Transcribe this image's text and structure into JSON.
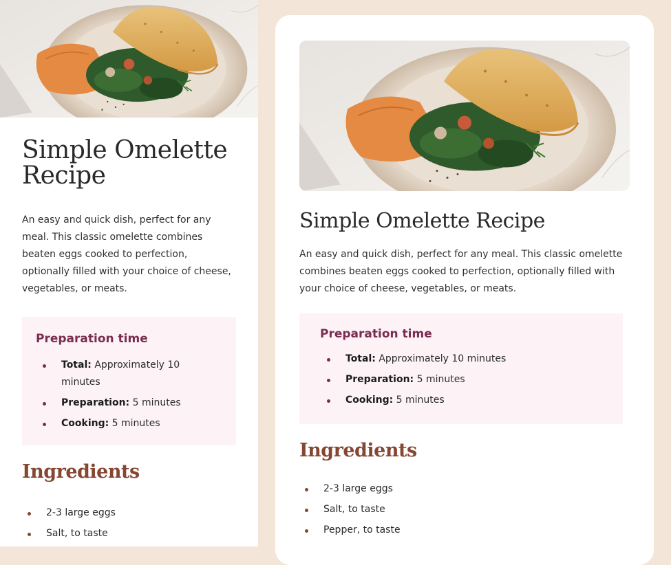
{
  "recipe": {
    "title": "Simple Omelette Recipe",
    "description": "An easy and quick dish, perfect for any meal. This classic omelette combines beaten eggs cooked to perfection, optionally filled with your choice of cheese, vegetables, or meats.",
    "preparation": {
      "heading": "Preparation time",
      "items": [
        {
          "label": "Total:",
          "value": "Approximately 10 minutes"
        },
        {
          "label": "Preparation:",
          "value": "5 minutes"
        },
        {
          "label": "Cooking:",
          "value": "5 minutes"
        }
      ]
    },
    "ingredients": {
      "heading": "Ingredients",
      "items": [
        "2-3 large eggs",
        "Salt, to taste",
        "Pepper, to taste"
      ]
    }
  },
  "image": {
    "icon": "omelette-photo"
  },
  "colors": {
    "page_background": "#f3e5d7",
    "card_background": "#ffffff",
    "prep_background": "#fdf3f7",
    "prep_accent": "#7a2c50",
    "ingredients_accent": "#854632"
  }
}
